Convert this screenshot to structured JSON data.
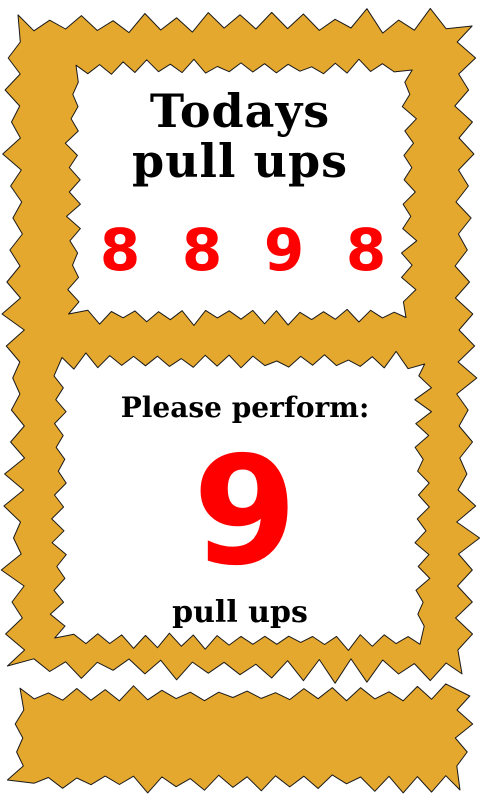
{
  "colors": {
    "frame": "#E5A82E",
    "digits": "#FF0000",
    "text": "#000000",
    "panel": "#FFFFFF"
  },
  "todays": {
    "title_line1": "Todays",
    "title_line2": "pull ups",
    "counts": [
      "8",
      "8",
      "9",
      "8"
    ]
  },
  "perform": {
    "label": "Please perform:",
    "value": "9",
    "unit": "pull ups"
  }
}
